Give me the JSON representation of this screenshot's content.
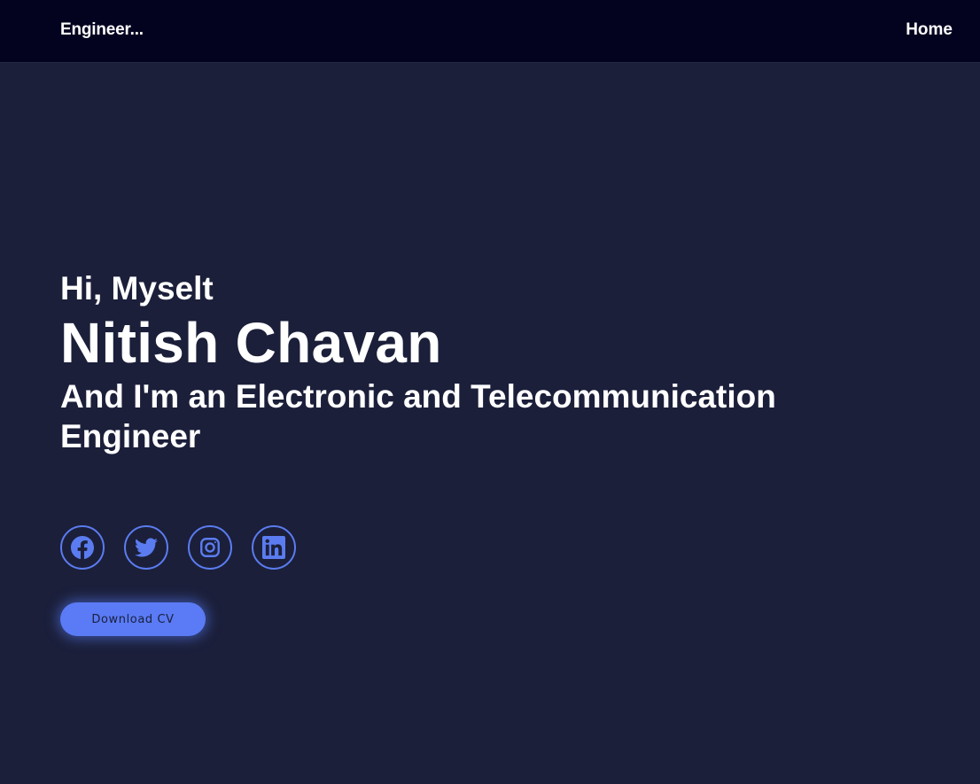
{
  "nav": {
    "brand": "Engineer...",
    "links": [
      {
        "label": "Home"
      }
    ]
  },
  "hero": {
    "greeting": "Hi, Myselt",
    "name": "Nitish Chavan",
    "tagline": "And I'm an Electronic and Telecommunication Engineer"
  },
  "socials": [
    {
      "icon": "facebook-icon"
    },
    {
      "icon": "twitter-icon"
    },
    {
      "icon": "instagram-icon"
    },
    {
      "icon": "linkedin-icon"
    }
  ],
  "cta": {
    "download_label": "Download CV"
  },
  "colors": {
    "background": "#1b1f3a",
    "navbar": "#03031f",
    "accent": "#5a7bf5",
    "text": "#ffffff"
  }
}
